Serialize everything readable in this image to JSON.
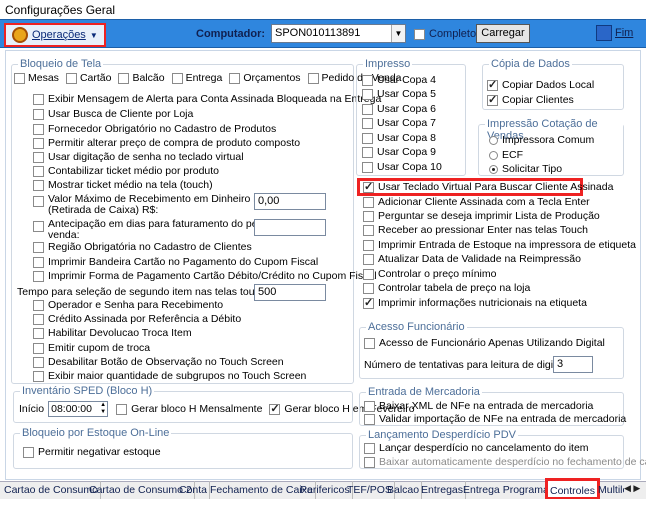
{
  "window_title": "Configurações Geral",
  "toolbar": {
    "operacoes_label": "Operações",
    "computador_label": "Computador:",
    "computador_value": "SPON010113891",
    "completo_label": "Completo",
    "carregar_label": "Carregar",
    "fim_label": "Fim"
  },
  "bloqueio_tela": {
    "title": "Bloqueio de Tela",
    "items": [
      "Mesas",
      "Cartão",
      "Balcão",
      "Entrega",
      "Orçamentos",
      "Pedido de Venda"
    ]
  },
  "left_options": [
    "Exibir Mensagem de Alerta para Conta Assinada Bloqueada na Entrega",
    "Usar Busca de Cliente por Loja",
    "Fornecedor Obrigatório no Cadastro de Produtos",
    "Permitir alterar preço de compra de produto composto",
    "Usar digitação de senha no teclado virtual",
    "Contabilizar ticket médio por produto",
    "Mostrar ticket médio na tela (touch)"
  ],
  "valor_maximo": {
    "label1": "Valor Máximo de Recebimento em Dinheiro no Caixa",
    "label2": "(Retirada de Caixa) R$:",
    "value": "0,00"
  },
  "antecipacao": {
    "label1": "Antecipação em dias para faturamento do pedido de",
    "label2": "venda:",
    "value": ""
  },
  "left_options2": [
    "Região Obrigatória no Cadastro de Clientes",
    "Imprimir Bandeira Cartão no Pagamento do Cupom Fiscal",
    "Imprimir Forma de Pagamento Cartão Débito/Crédito no Cupom Fiscal"
  ],
  "tempo_selecao": {
    "label": "Tempo para seleção de segundo item nas telas touch:",
    "value": "500"
  },
  "left_options3": [
    "Operador e Senha para Recebimento",
    "Crédito Assinada por Referência a Débito",
    "Habilitar Devolucao Troca Item",
    "Emitir cupom de troca",
    "Desabilitar Botão de Observação no Touch Screen",
    "Exibir maior quantidade de subgrupos no Touch Screen"
  ],
  "inventario": {
    "title": "Inventário SPED (Bloco H)",
    "inicio_label": "Início",
    "inicio_value": "08:00:00",
    "mensal_label": "Gerar bloco H Mensalmente",
    "fevereiro_label": "Gerar bloco H em Fevereiro"
  },
  "bloqueio_estoque": {
    "title": "Bloqueio por Estoque On-Line",
    "item": "Permitir negativar estoque"
  },
  "impresso": {
    "title": "Impresso",
    "copas": [
      "Usar Copa 4",
      "Usar Copa 5",
      "Usar Copa 6",
      "Usar Copa 7",
      "Usar Copa 8",
      "Usar Copa 9",
      "Usar Copa 10"
    ]
  },
  "copia_dados": {
    "title": "Cópia de Dados",
    "items": [
      "Copiar Dados Local",
      "Copiar Clientes"
    ]
  },
  "impressao_cotacao": {
    "title": "Impressão Cotação de Vendas",
    "items": [
      "Impressora Comum",
      "ECF",
      "Solicitar Tipo"
    ]
  },
  "mid_options": [
    "Usar Teclado Virtual Para Buscar Cliente Assinada",
    "Adicionar Cliente Assinada com a Tecla Enter",
    "Perguntar se deseja imprimir Lista de Produção",
    "Receber ao pressionar Enter nas telas Touch",
    "Imprimir Entrada de Estoque na impressora de etiqueta",
    "Atualizar Data de Validade na Reimpressão",
    "Controlar o preço mínimo",
    "Controlar tabela de preço na loja",
    "Imprimir informações nutricionais na etiqueta"
  ],
  "acesso_funcionario": {
    "title": "Acesso Funcionário",
    "item": "Acesso de Funcionário Apenas Utilizando Digital",
    "tentativas_label": "Número de tentativas para leitura de digital:",
    "tentativas_value": "3"
  },
  "entrada_mercadoria": {
    "title": "Entrada de Mercadoria",
    "items": [
      "Baixar XML de NFe na entrada de mercadoria",
      "Validar importação de NFe na entrada de mercadoria"
    ]
  },
  "lancamento_desperdicio": {
    "title": "Lançamento Desperdício PDV",
    "items": [
      "Lançar desperdício no cancelamento do item",
      "Baixar automaticamente desperdício no fechamento de caixa"
    ]
  },
  "tabs": [
    "Cartao de Consumo",
    "Cartao de Consumo 2",
    "Conta",
    "Fechamento de Caixa",
    "Perifericos",
    "TEF/POS",
    "Balcao",
    "Entregas",
    "Entrega Programad",
    "Controles",
    "Multiloj"
  ],
  "colors": {
    "toolbar": "#2f86de",
    "highlight": "#e22222",
    "group_title": "#4d6f99"
  }
}
